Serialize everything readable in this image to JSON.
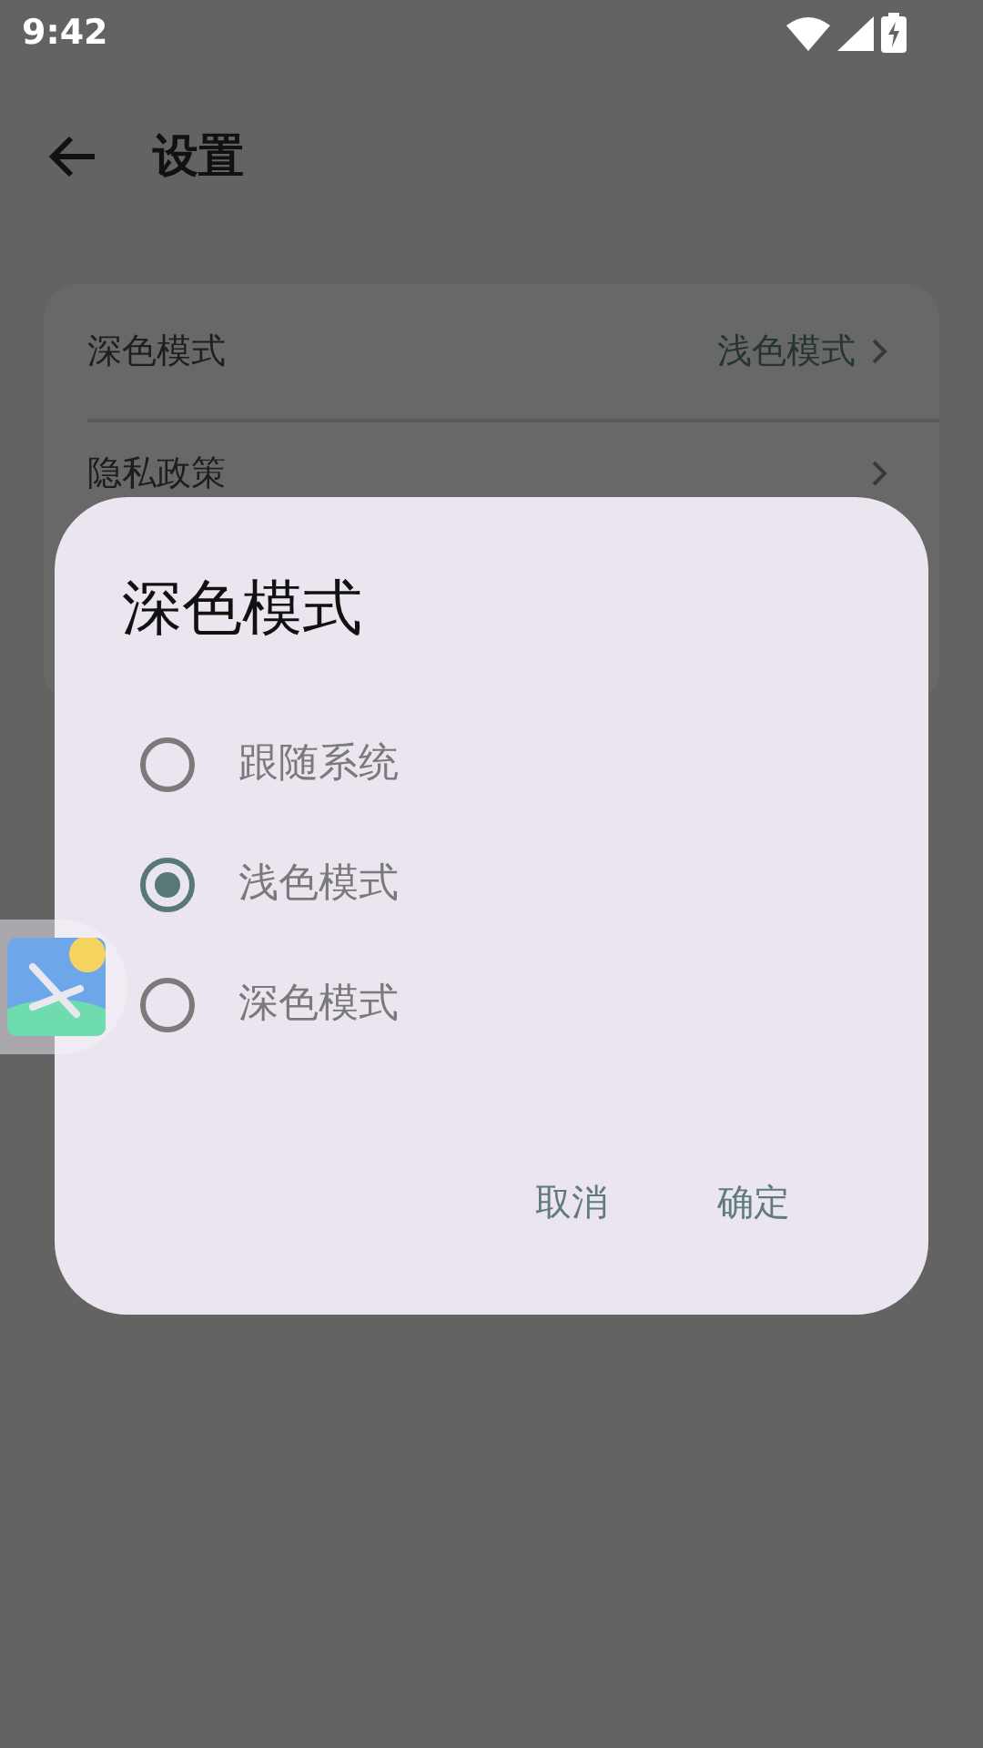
{
  "status_bar": {
    "time": "9:42"
  },
  "toolbar": {
    "title": "设置"
  },
  "settings": [
    {
      "label": "深色模式",
      "value": "浅色模式"
    },
    {
      "label": "隐私政策"
    }
  ],
  "dialog": {
    "title": "深色模式",
    "options": [
      {
        "label": "跟随系统",
        "selected": false
      },
      {
        "label": "浅色模式",
        "selected": true
      },
      {
        "label": "深色模式",
        "selected": false
      }
    ],
    "buttons": [
      "取消",
      "确定"
    ]
  }
}
